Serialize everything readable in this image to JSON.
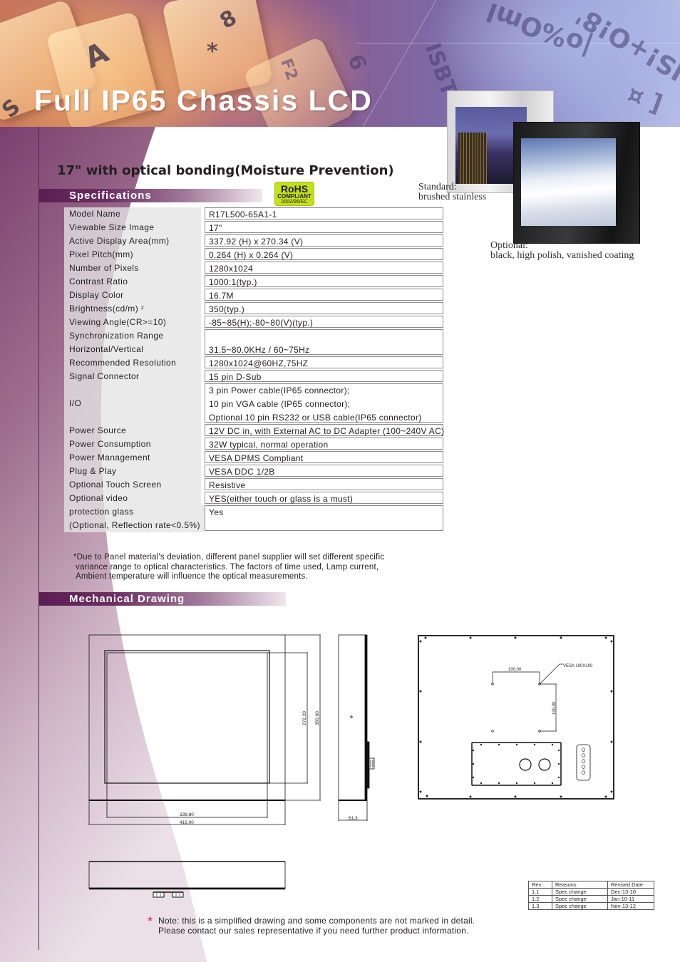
{
  "header": {
    "title": "Full IP65 Chassis LCD",
    "banner_glyphs": [
      "A",
      "8",
      "*",
      "F2",
      "6",
      "S",
      "ISBT",
      "|o%Oml",
      "IS!+O!8'",
      "[ ¤"
    ]
  },
  "subtitle": "17\" with optical bonding(Moisture Prevention)",
  "badge": {
    "line1": "RoHS",
    "line2": "COMPLIANT",
    "line3": "2002/95/EC",
    "color": "#c3e01e"
  },
  "photos": {
    "standard_caption_line1": "Standard:",
    "standard_caption_line2": "brushed stainless",
    "optional_caption_line1": "Optional:",
    "optional_caption_line2": "black, high polish, vanished coating"
  },
  "sections": {
    "specifications": "Specifications",
    "mechanical_drawing": "Mechanical Drawing"
  },
  "specs": [
    {
      "label": "Model Name",
      "value": "R17L500-65A1-1"
    },
    {
      "label": "Viewable Size Image",
      "value": "17\""
    },
    {
      "label": "Active Display Area(mm)",
      "value": "337.92 (H) x 270.34 (V)"
    },
    {
      "label": "Pixel Pitch(mm)",
      "value": "0.264 (H) x 0.264 (V)"
    },
    {
      "label": "Number of Pixels",
      "value": "1280x1024"
    },
    {
      "label": "Contrast Ratio",
      "value": "1000:1(typ.)"
    },
    {
      "label": "Display Color",
      "value": "16.7M"
    },
    {
      "label": "Brightness(cd/m)",
      "label_sup": "2",
      "value": "350(typ.)"
    },
    {
      "label": "Viewing Angle(CR>=10)",
      "value": "-85~85(H);-80~80(V)(typ.)"
    },
    {
      "label": "Synchronization Range",
      "label2": "Horizontal/Vertical",
      "value": "",
      "value2": "31.5~80.0KHz / 60~75Hz"
    },
    {
      "label": "Recommended Resolution",
      "value": "1280x1024@60HZ,75HZ"
    },
    {
      "label": "Signal Connector",
      "value": "15 pin D-Sub"
    },
    {
      "label": "I/O",
      "value": "3 pin Power cable(IP65 connector);",
      "value2": "10 pin VGA cable (IP65 connector);",
      "value3": "Optional 10 pin RS232 or USB cable(IP65 connector)"
    },
    {
      "label": "Power Source",
      "value": "12V DC in, with External AC to DC Adapter (100~240V AC)"
    },
    {
      "label": "Power Consumption",
      "value": "32W typical, normal operation"
    },
    {
      "label": "Power Management",
      "value": "VESA DPMS Compliant"
    },
    {
      "label": "Plug & Play",
      "value": "VESA DDC 1/2B"
    },
    {
      "label": "Optional Touch Screen",
      "value": "Resistive"
    },
    {
      "label": "Optional video",
      "value": "YES(either touch or glass is a must)"
    },
    {
      "label": "protection glass",
      "label2": "(Optional, Reflection rate<0.5%)",
      "value": "Yes"
    }
  ],
  "footnote": [
    "*Due to Panel material's deviation, different panel supplier will set different specific",
    "variance range to optical characteristics. The factors of time used, Lamp current,",
    "Ambient temperature will influence the optical measurements."
  ],
  "drawing": {
    "front_dims": {
      "inner_width": "339,80",
      "outer_width": "416,00",
      "inner_height": "272,20",
      "outer_height": "350,00"
    },
    "side_dims": {
      "depth": "61,3"
    },
    "rear_dims": {
      "vesa_h": "100,00",
      "vesa_v": "100,00",
      "vesa_label": "VESA 100X100"
    }
  },
  "revisions": {
    "headers": [
      "Rev.",
      "Reasons",
      "Revised Date"
    ],
    "rows": [
      [
        "1.1",
        "Spec change",
        "Dec-13-10"
      ],
      [
        "1.2",
        "Spec change",
        "Jan-10-11"
      ],
      [
        "1.3",
        "Spec change",
        "Nov-13-12"
      ]
    ]
  },
  "note": {
    "star": "*",
    "line1": "Note: this is a simplified drawing and some components are not marked in detail.",
    "line2": "Please contact our sales representative if you need further product information."
  },
  "colors": {
    "brand_purple": "#5a1f52",
    "note_star": "#e8202a"
  }
}
